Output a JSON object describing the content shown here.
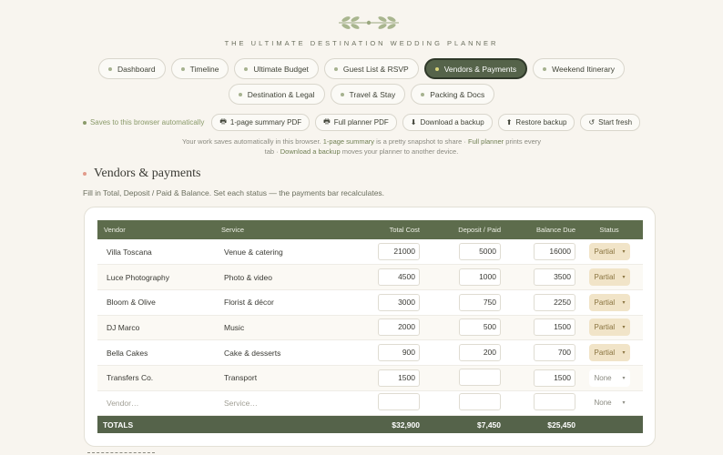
{
  "header": {
    "tagline": "THE ULTIMATE DESTINATION WEDDING PLANNER",
    "logo_icon": "leaf-sprig-icon"
  },
  "nav": {
    "row1": [
      {
        "label": "Dashboard",
        "active": false
      },
      {
        "label": "Timeline",
        "active": false
      },
      {
        "label": "Ultimate Budget",
        "active": false
      },
      {
        "label": "Guest List & RSVP",
        "active": false
      },
      {
        "label": "Vendors & Payments",
        "active": true
      },
      {
        "label": "Weekend Itinerary",
        "active": false
      }
    ],
    "row2": [
      {
        "label": "Destination & Legal",
        "active": false
      },
      {
        "label": "Travel & Stay",
        "active": false
      },
      {
        "label": "Packing & Docs",
        "active": false
      }
    ]
  },
  "toolbar": {
    "autosave": "Saves to this browser automatically",
    "summary_pdf": "1-page summary PDF",
    "full_pdf": "Full planner PDF",
    "download": "Download a backup",
    "restore": "Restore backup",
    "start_fresh": "Start fresh",
    "icons": {
      "summary_pdf": "printer-icon",
      "full_pdf": "printer-icon",
      "download": "download-arrow-icon",
      "restore": "upload-arrow-icon",
      "start_fresh": "refresh-icon"
    }
  },
  "info": {
    "part1": "Your work saves automatically in this browser. ",
    "link1": "1-page summary",
    "part2": " is a pretty snapshot to share · ",
    "link2": "Full planner",
    "part3": " prints every tab · ",
    "link3": "Download a backup",
    "part4": " moves your planner to another device."
  },
  "section": {
    "title": "Vendors & payments",
    "subtitle": "Fill in Total, Deposit / Paid & Balance. Set each status — the payments bar recalculates."
  },
  "table": {
    "headers": {
      "vendor": "Vendor",
      "service": "Service",
      "total": "Total Cost",
      "deposit": "Deposit / Paid",
      "balance": "Balance Due",
      "status": "Status"
    },
    "rows": [
      {
        "vendor": "Villa Toscana",
        "service": "Venue & catering",
        "total": "21000",
        "deposit": "5000",
        "balance": "16000",
        "status": "Partial"
      },
      {
        "vendor": "Luce Photography",
        "service": "Photo & video",
        "total": "4500",
        "deposit": "1000",
        "balance": "3500",
        "status": "Partial"
      },
      {
        "vendor": "Bloom & Olive",
        "service": "Florist & décor",
        "total": "3000",
        "deposit": "750",
        "balance": "2250",
        "status": "Partial"
      },
      {
        "vendor": "DJ Marco",
        "service": "Music",
        "total": "2000",
        "deposit": "500",
        "balance": "1500",
        "status": "Partial"
      },
      {
        "vendor": "Bella Cakes",
        "service": "Cake & desserts",
        "total": "900",
        "deposit": "200",
        "balance": "700",
        "status": "Partial"
      },
      {
        "vendor": "Transfers Co.",
        "service": "Transport",
        "total": "1500",
        "deposit": "",
        "balance": "1500",
        "status": "None"
      }
    ],
    "placeholder_row": {
      "vendor": "Vendor…",
      "service": "Service…",
      "status": "None"
    },
    "totals": {
      "label": "TOTALS",
      "total": "$32,900",
      "deposit": "$7,450",
      "balance": "$25,450"
    }
  },
  "colors": {
    "accent": "#55634a",
    "background": "#f8f5ef",
    "partial_bg": "#f1e4c8"
  }
}
